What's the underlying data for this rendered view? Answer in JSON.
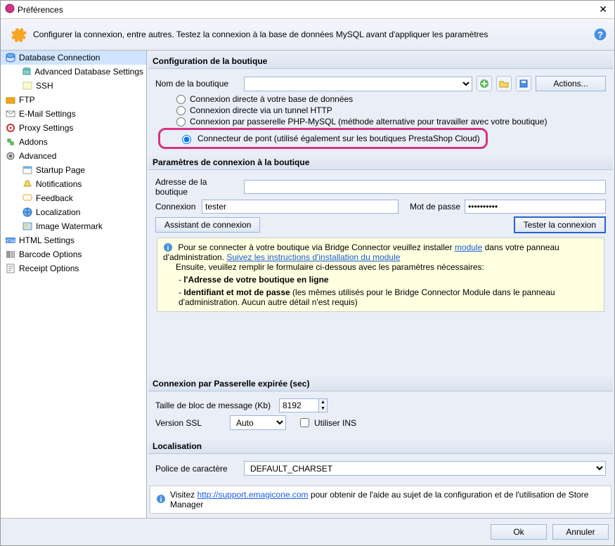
{
  "window": {
    "title": "Préférences"
  },
  "header": {
    "desc": "Configurer la connexion, entre autres. Testez la connexion à la base de données MySQL avant d'appliquer les paramètres"
  },
  "sidebar": {
    "items": [
      {
        "label": "Database Connection",
        "icon": "db",
        "selected": true,
        "children": [
          {
            "label": "Advanced Database Settings",
            "icon": "dbadv"
          },
          {
            "label": "SSH",
            "icon": "ssh"
          }
        ]
      },
      {
        "label": "FTP",
        "icon": "ftp"
      },
      {
        "label": "E-Mail Settings",
        "icon": "mail"
      },
      {
        "label": "Proxy Settings",
        "icon": "proxy"
      },
      {
        "label": "Addons",
        "icon": "addons"
      },
      {
        "label": "Advanced",
        "icon": "adv",
        "children": [
          {
            "label": "Startup Page",
            "icon": "startup"
          },
          {
            "label": "Notifications",
            "icon": "notif"
          },
          {
            "label": "Feedback",
            "icon": "feedback"
          },
          {
            "label": "Localization",
            "icon": "loc"
          },
          {
            "label": "Image Watermark",
            "icon": "watermark"
          }
        ]
      },
      {
        "label": "HTML Settings",
        "icon": "html"
      },
      {
        "label": "Barcode Options",
        "icon": "barcode"
      },
      {
        "label": "Receipt Options",
        "icon": "receipt"
      }
    ]
  },
  "sections": {
    "config": {
      "title": "Configuration de la boutique",
      "storeName": {
        "label": "Nom de la boutique",
        "value": ""
      },
      "actions": "Actions...",
      "radios": {
        "r1": "Connexion directe à votre base de données",
        "r2": "Connexion directe via un tunnel HTTP",
        "r3": "Connexion par passerelle PHP-MySQL (méthode alternative pour travailler avec votre boutique)",
        "r4": "Connecteur de pont (utilisé également sur les boutiques PrestaShop Cloud)"
      }
    },
    "params": {
      "title": "Paramètres de connexion à la boutique",
      "address": {
        "label": "Adresse de la boutique",
        "value": ""
      },
      "login": {
        "label": "Connexion",
        "value": "tester"
      },
      "password": {
        "label": "Mot de passe",
        "value": "••••••••••"
      },
      "btnWizard": "Assistant de connexion",
      "btnTest": "Tester la connexion"
    },
    "info": {
      "line1_pre": "Pour se connecter à votre boutique via Bridge Connector veuillez installer ",
      "line1_link1": "module",
      "line1_mid": " dans votre panneau d'administration. ",
      "line1_link2": "Suivez les instructions d'installation du module",
      "line2": "Ensuite, veuillez remplir le formulaire ci-dessous avec les paramètres nécessaires:",
      "b1": "l'Adresse de votre boutique en ligne",
      "b2_bold": "Identifiant et mot de passe",
      "b2_rest": " (les mêmes utilisés pour le Bridge Connector Module dans le panneau d'administration. Aucun autre détail n'est requis)"
    },
    "gateway": {
      "title": "Connexion par Passerelle expirée (sec)",
      "blockLabel": "Taille de bloc de message (Kb)",
      "blockValue": "8192",
      "sslLabel": "Version SSL",
      "sslValue": "Auto",
      "insLabel": "Utiliser INS"
    },
    "locale": {
      "title": "Localisation",
      "fontLabel": "Police de caractère",
      "fontValue": "DEFAULT_CHARSET"
    },
    "visit": {
      "pre": "Visitez ",
      "link": "http://support.emagicone.com",
      "post": " pour obtenir de l'aide au sujet de la configuration et de l'utilisation de Store Manager"
    }
  },
  "footer": {
    "ok": "Ok",
    "cancel": "Annuler"
  }
}
